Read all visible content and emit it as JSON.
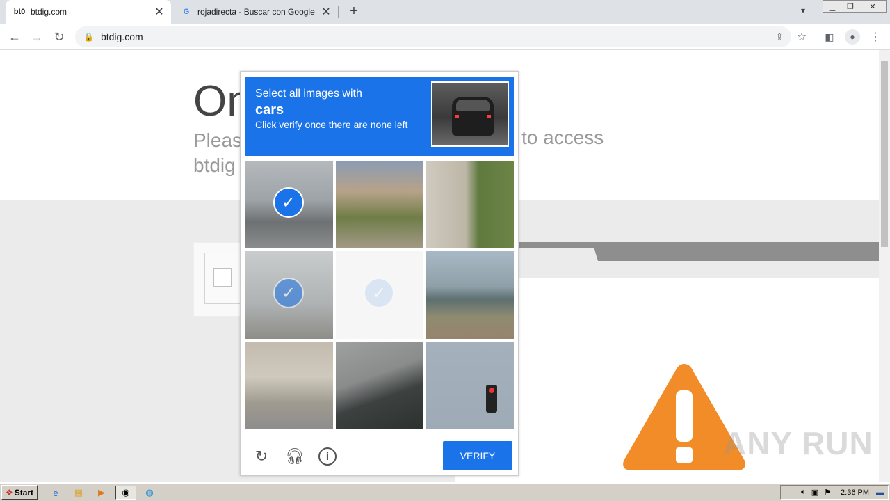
{
  "browser": {
    "tabs": [
      {
        "label": "btdig.com",
        "favicon_text": "bt0",
        "active": true
      },
      {
        "label": "rojadirecta - Buscar con Google",
        "favicon_text": "G",
        "active": false
      }
    ],
    "new_tab_symbol": "+",
    "url": "btdig.com"
  },
  "page": {
    "title": "On",
    "subtitle_start": "Pleas",
    "subtitle_end": "to access",
    "subtitle_line2": "btdig"
  },
  "captcha": {
    "instruction": "Select all images with",
    "target": "cars",
    "hint": "Click verify once there are none left",
    "verify_label": "VERIFY",
    "tiles": [
      {
        "state": "selected"
      },
      {
        "state": "normal"
      },
      {
        "state": "normal"
      },
      {
        "state": "selected-fading"
      },
      {
        "state": "loading"
      },
      {
        "state": "normal"
      },
      {
        "state": "normal"
      },
      {
        "state": "normal"
      },
      {
        "state": "normal"
      }
    ]
  },
  "watermark": "ANY RUN",
  "taskbar": {
    "start_label": "Start",
    "clock": "2:36 PM"
  },
  "colors": {
    "captcha_blue": "#1a73e8",
    "warning_orange": "#f28c28"
  }
}
